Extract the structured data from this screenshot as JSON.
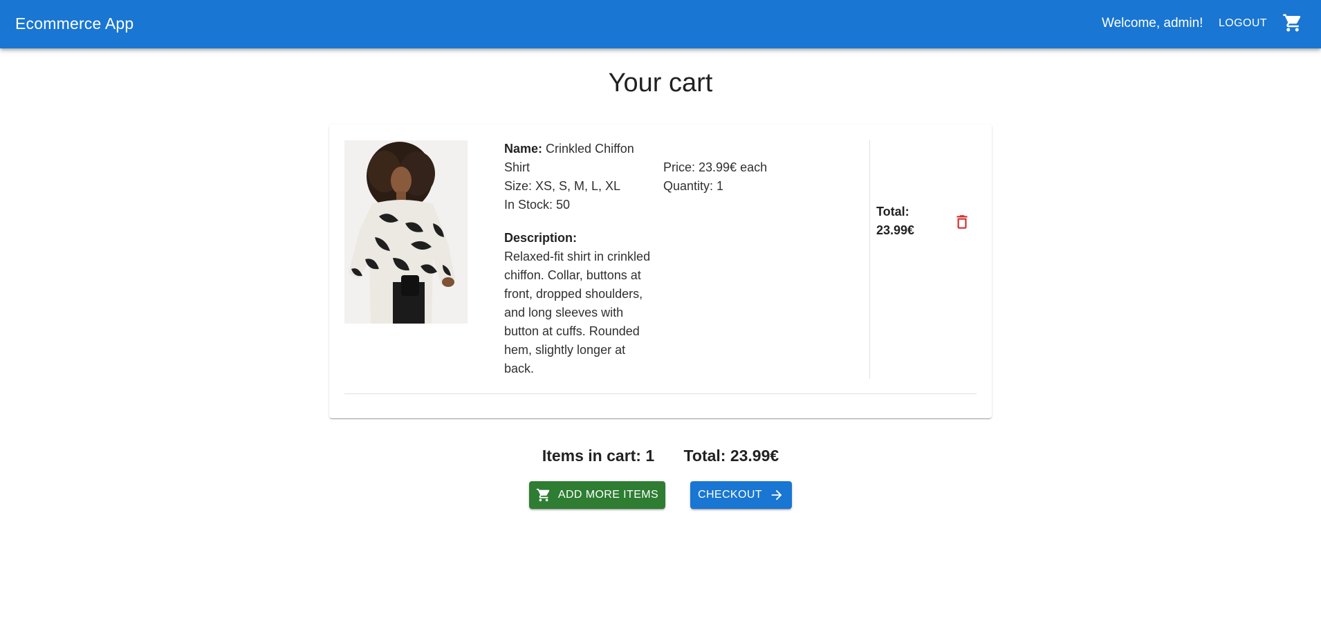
{
  "appbar": {
    "title": "Ecommerce App",
    "welcome": "Welcome, admin!",
    "logout_label": "LOGOUT",
    "cart_icon": "shopping-cart-icon"
  },
  "page": {
    "title": "Your cart"
  },
  "cart": {
    "items": [
      {
        "name_label": "Name:",
        "name": "Crinkled Chiffon Shirt",
        "size": "Size: XS, S, M, L, XL",
        "stock": "In Stock: 50",
        "description_label": "Description:",
        "description": "Relaxed-fit shirt in crinkled chiffon. Collar, buttons at front, dropped shoulders, and long sleeves with button at cuffs. Rounded hem, slightly longer at back.",
        "price": "Price: 23.99€ each",
        "quantity": "Quantity: 1",
        "total": "Total: 23.99€",
        "delete_icon": "trash-icon"
      }
    ]
  },
  "summary": {
    "items_in_cart": "Items in cart: 1",
    "total": "Total: 23.99€"
  },
  "actions": {
    "add_more_label": "ADD MORE ITEMS",
    "checkout_label": "CHECKOUT"
  },
  "colors": {
    "primary": "#1976d2",
    "success": "#2e7d32",
    "danger": "#d32f2f"
  }
}
